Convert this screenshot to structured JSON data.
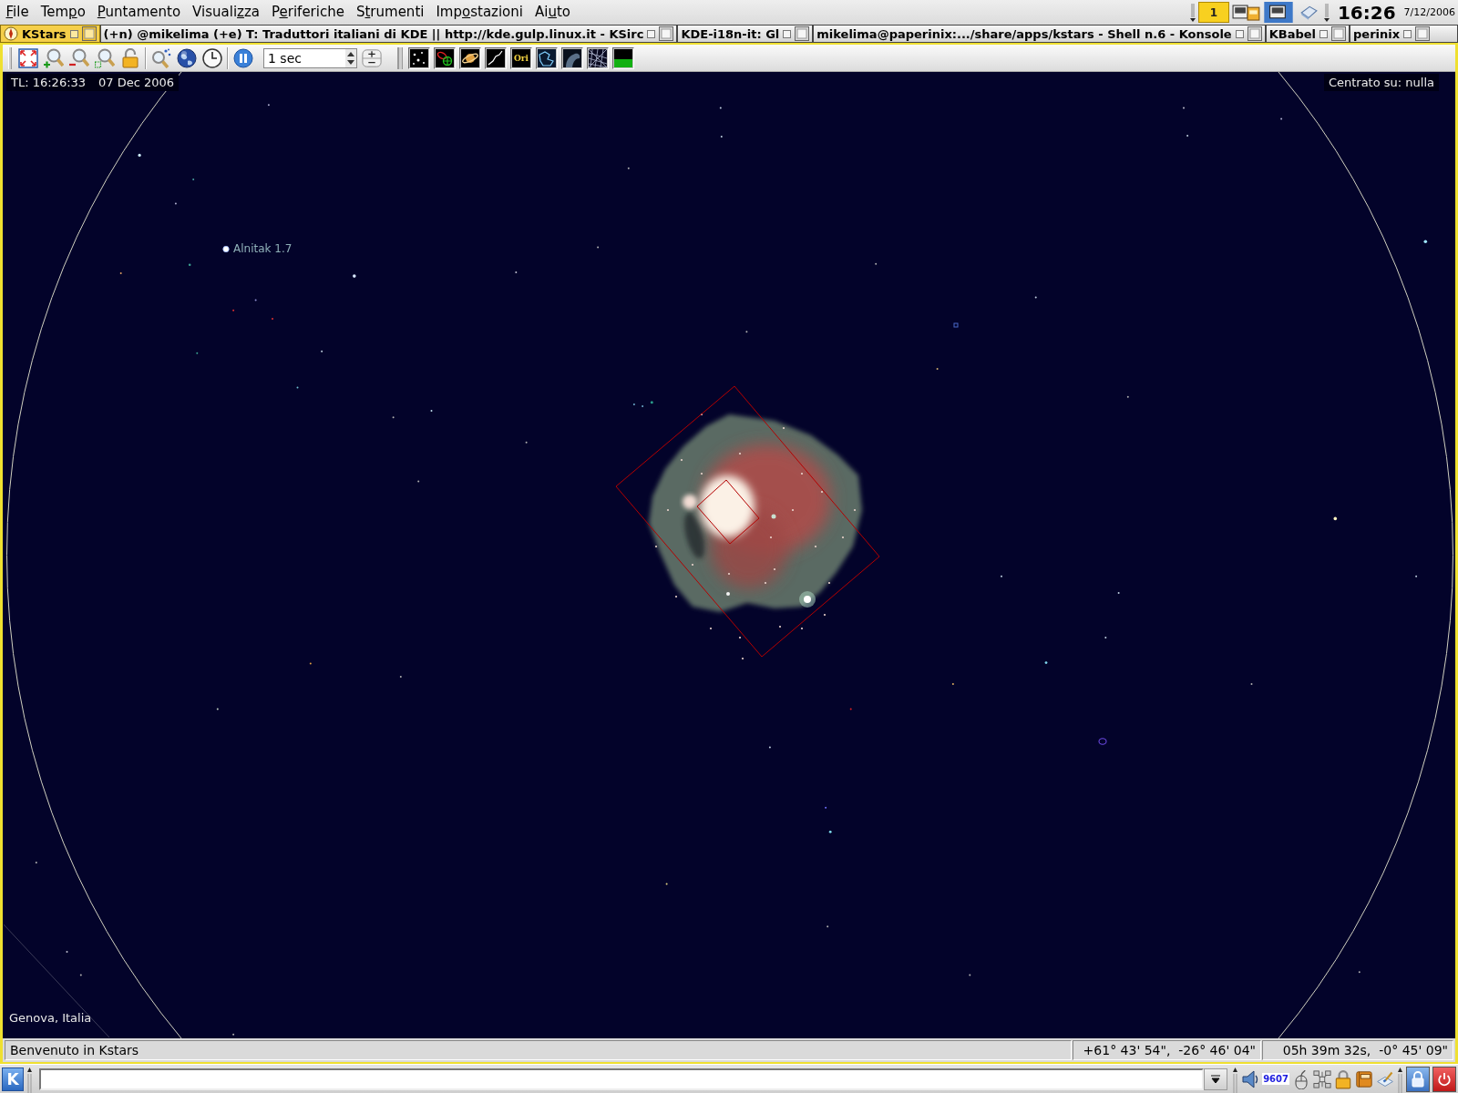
{
  "menu_bar": {
    "items": [
      {
        "key": "F",
        "after": "ile"
      },
      {
        "before": "Tem",
        "key": "p",
        "after": "o"
      },
      {
        "key": "P",
        "after": "untamento"
      },
      {
        "before": "Visuali",
        "key": "z",
        "after": "za"
      },
      {
        "before": "P",
        "key": "e",
        "after": "riferiche"
      },
      {
        "before": "S",
        "key": "t",
        "after": "rumenti"
      },
      {
        "before": "Imp",
        "key": "o",
        "after": "stazioni"
      },
      {
        "before": "Ai",
        "key": "u",
        "after": "to"
      }
    ]
  },
  "system_tray": {
    "desktop": "1",
    "clock": "16:26",
    "date": "7/12/2006"
  },
  "taskbar": {
    "tasks": [
      {
        "title": "KStars",
        "selected": true
      },
      {
        "title": "(+n) @mikelima (+e) T: Traduttori italiani di KDE || http://kde.gulp.linux.it - KSirc",
        "selected": false
      },
      {
        "title": "KDE-i18n-it: Gl",
        "selected": false
      },
      {
        "title": "mikelima@paperinix:.../share/apps/kstars - Shell n.6 - Konsole",
        "selected": false
      },
      {
        "title": "KBabel",
        "selected": false
      },
      {
        "title": "perinix",
        "selected": false
      }
    ]
  },
  "toolbar": {
    "time_step": "1 sec",
    "view_toggles": [
      {
        "kind": "stars",
        "on": true
      },
      {
        "kind": "deepsky",
        "on": true
      },
      {
        "kind": "planets",
        "on": true
      },
      {
        "kind": "lines",
        "on": true
      },
      {
        "kind": "names",
        "label": "Ori",
        "on": true
      },
      {
        "kind": "boundaries",
        "on": true
      },
      {
        "kind": "milkyway",
        "on": true
      },
      {
        "kind": "grid",
        "on": true
      },
      {
        "kind": "horizon",
        "on": true
      }
    ]
  },
  "sky_map": {
    "time": "TL: 16:26:33",
    "date": "07 Dec 2006",
    "centered_on": "Centrato su: nulla",
    "star_label": "Alnitak 1.7",
    "location": "Genova, Italia"
  },
  "status_bar": {
    "message": "Benvenuto in Kstars",
    "coordinates": [
      "+61° 43' 54\",  -26° 46' 04\"",
      "05h 39m 32s,  -0° 45' 09\""
    ]
  },
  "panel": {
    "start_button": "K",
    "counter": "9607"
  }
}
